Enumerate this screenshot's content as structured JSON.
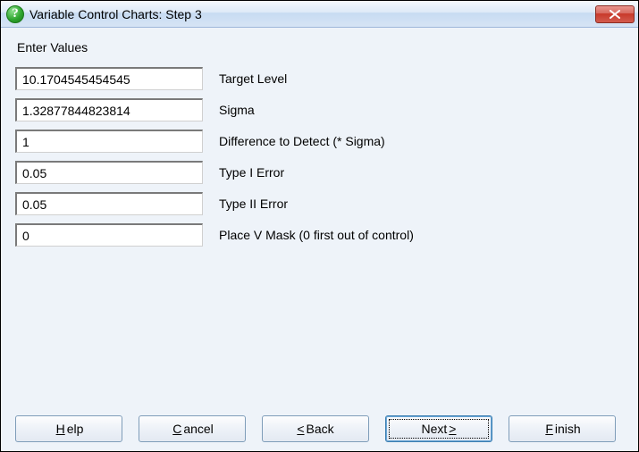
{
  "window": {
    "title": "Variable Control Charts: Step 3"
  },
  "instruction": "Enter Values",
  "fields": {
    "target_level": {
      "label": "Target Level",
      "value": "10.1704545454545"
    },
    "sigma": {
      "label": "Sigma",
      "value": "1.32877844823814"
    },
    "diff": {
      "label": "Difference to Detect (* Sigma)",
      "value": "1"
    },
    "type1": {
      "label": "Type I Error",
      "value": "0.05"
    },
    "type2": {
      "label": "Type II Error",
      "value": "0.05"
    },
    "vmask": {
      "label": "Place V Mask (0 first out of control)",
      "value": "0"
    }
  },
  "buttons": {
    "help": {
      "pre": "",
      "m": "H",
      "post": "elp"
    },
    "cancel": {
      "pre": "",
      "m": "C",
      "post": "ancel"
    },
    "back": {
      "pre": "",
      "m": "<",
      "post": " Back"
    },
    "next": {
      "pre": "Next ",
      "m": ">",
      "post": ""
    },
    "finish": {
      "pre": "",
      "m": "F",
      "post": "inish"
    }
  }
}
